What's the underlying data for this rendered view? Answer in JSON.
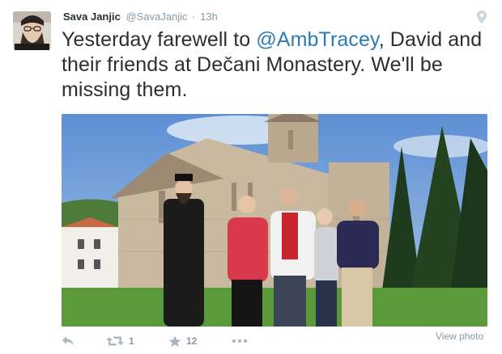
{
  "tweet": {
    "author_name": "Sava Janjic",
    "username": "@SavaJanjic",
    "separator": "·",
    "timestamp": "13h",
    "text_before_mention": "Yesterday farewell to ",
    "mention": "@AmbTracey",
    "text_after_mention": ", David and their friends at Dečani Monastery. We'll be missing them."
  },
  "actions": {
    "retweet_count": "1",
    "favorite_count": "12",
    "view_photo_label": "View photo"
  },
  "colors": {
    "link": "#2b7bb9",
    "muted": "#8899a6",
    "text": "#292f33"
  },
  "icons": [
    "geo-pin-icon",
    "reply-icon",
    "retweet-icon",
    "star-icon",
    "more-icon"
  ]
}
